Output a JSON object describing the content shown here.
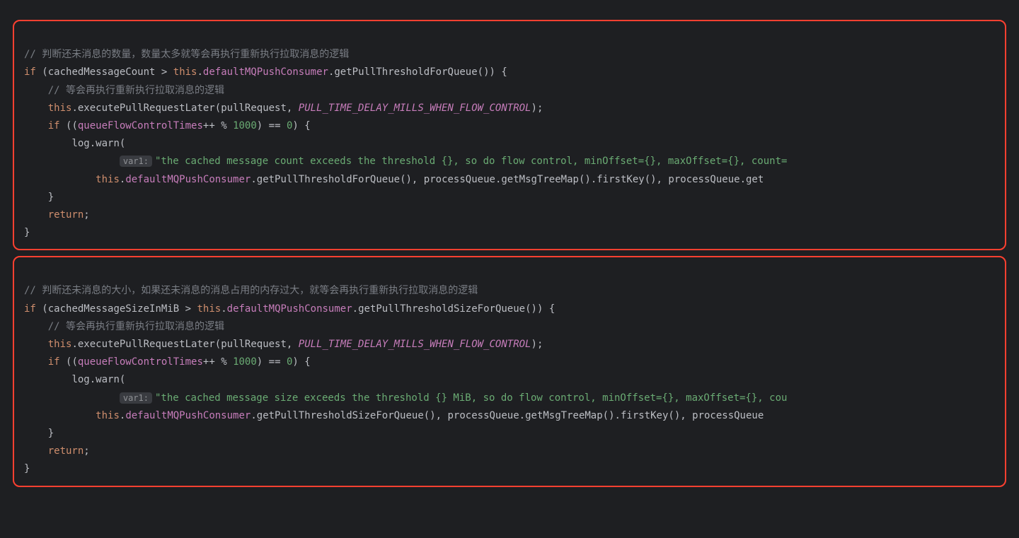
{
  "block1": {
    "comment1": "// 判断还未消息的数量，数量太多就等会再执行重新执行拉取消息的逻辑",
    "if_kw": "if",
    "var1": "cachedMessageCount",
    "gt": ">",
    "this1": "this",
    "field1": "defaultMQPushConsumer",
    "method1": "getPullThresholdForQueue",
    "brace_open": "{",
    "comment2": "// 等会再执行重新执行拉取消息的逻辑",
    "this2": "this",
    "method2": "executePullRequestLater",
    "arg1": "pullRequest",
    "const1": "PULL_TIME_DELAY_MILLS_WHEN_FLOW_CONTROL",
    "if_kw2": "if",
    "var2": "queueFlowControlTimes",
    "inc": "++",
    "mod": "%",
    "num1000": "1000",
    "eqeq": "==",
    "num0": "0",
    "log": "log",
    "warn": "warn",
    "hint1": "var1:",
    "str1": "\"the cached message count exceeds the threshold {}, so do flow control, minOffset={}, maxOffset={}, count=",
    "this3": "this",
    "field3": "defaultMQPushConsumer",
    "method3": "getPullThresholdForQueue",
    "pq1": "processQueue",
    "gmt": "getMsgTreeMap",
    "fk": "firstKey",
    "pq2": "processQueue",
    "get_tail": "get",
    "close1": "}",
    "return_kw": "return",
    "close2": "}"
  },
  "block2": {
    "comment1": "// 判断还未消息的大小，如果还未消息的消息占用的内存过大，就等会再执行重新执行拉取消息的逻辑",
    "if_kw": "if",
    "var1": "cachedMessageSizeInMiB",
    "gt": ">",
    "this1": "this",
    "field1": "defaultMQPushConsumer",
    "method1": "getPullThresholdSizeForQueue",
    "brace_open": "{",
    "comment2": "// 等会再执行重新执行拉取消息的逻辑",
    "this2": "this",
    "method2": "executePullRequestLater",
    "arg1": "pullRequest",
    "const1": "PULL_TIME_DELAY_MILLS_WHEN_FLOW_CONTROL",
    "if_kw2": "if",
    "var2": "queueFlowControlTimes",
    "inc": "++",
    "mod": "%",
    "num1000": "1000",
    "eqeq": "==",
    "num0": "0",
    "log": "log",
    "warn": "warn",
    "hint1": "var1:",
    "str1": "\"the cached message size exceeds the threshold {} MiB, so do flow control, minOffset={}, maxOffset={}, cou",
    "this3": "this",
    "field3": "defaultMQPushConsumer",
    "method3": "getPullThresholdSizeForQueue",
    "pq1": "processQueue",
    "gmt": "getMsgTreeMap",
    "fk": "firstKey",
    "pq2": "processQueue",
    "get_tail": "",
    "close1": "}",
    "return_kw": "return",
    "close2": "}"
  }
}
